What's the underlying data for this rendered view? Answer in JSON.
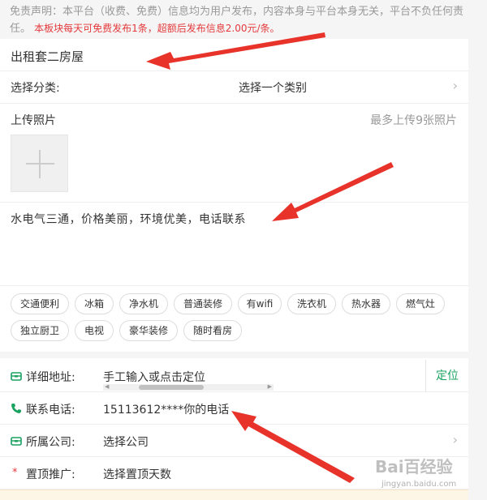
{
  "disclaimer": {
    "text": "免责声明：本平台（收费、免费）信息均为用户发布，内容本身与平台本身无关，平台不负任何责任。",
    "notice": "本板块每天可免费发布1条，超额后发布信息2.00元/条。"
  },
  "form": {
    "title": "出租套二房屋",
    "category": {
      "label": "选择分类:",
      "value": "选择一个类别"
    },
    "photos": {
      "label": "上传照片",
      "hint": "最多上传9张照片"
    },
    "description": "水电气三通，价格美丽，环境优美，电话联系",
    "tags": [
      "交通便利",
      "冰箱",
      "净水机",
      "普通装修",
      "有wifi",
      "洗衣机",
      "热水器",
      "燃气灶",
      "独立厨卫",
      "电视",
      "豪华装修",
      "随时看房"
    ],
    "address": {
      "label": "详细地址:",
      "placeholder": "手工输入或点击定位",
      "locate_label": "定位"
    },
    "phone": {
      "label": "联系电话:",
      "value": "15113612****你的电话"
    },
    "company": {
      "label": "所属公司:",
      "value": "选择公司"
    },
    "promotion": {
      "label": "置顶推广:",
      "value": "选择置顶天数"
    }
  },
  "watermark": {
    "main": "Bai百经验",
    "sub": "jingyan.baidu.com"
  },
  "colors": {
    "accent_green": "#1aa260",
    "alert_red": "#e4393c",
    "arrow_red": "#e8332b"
  }
}
